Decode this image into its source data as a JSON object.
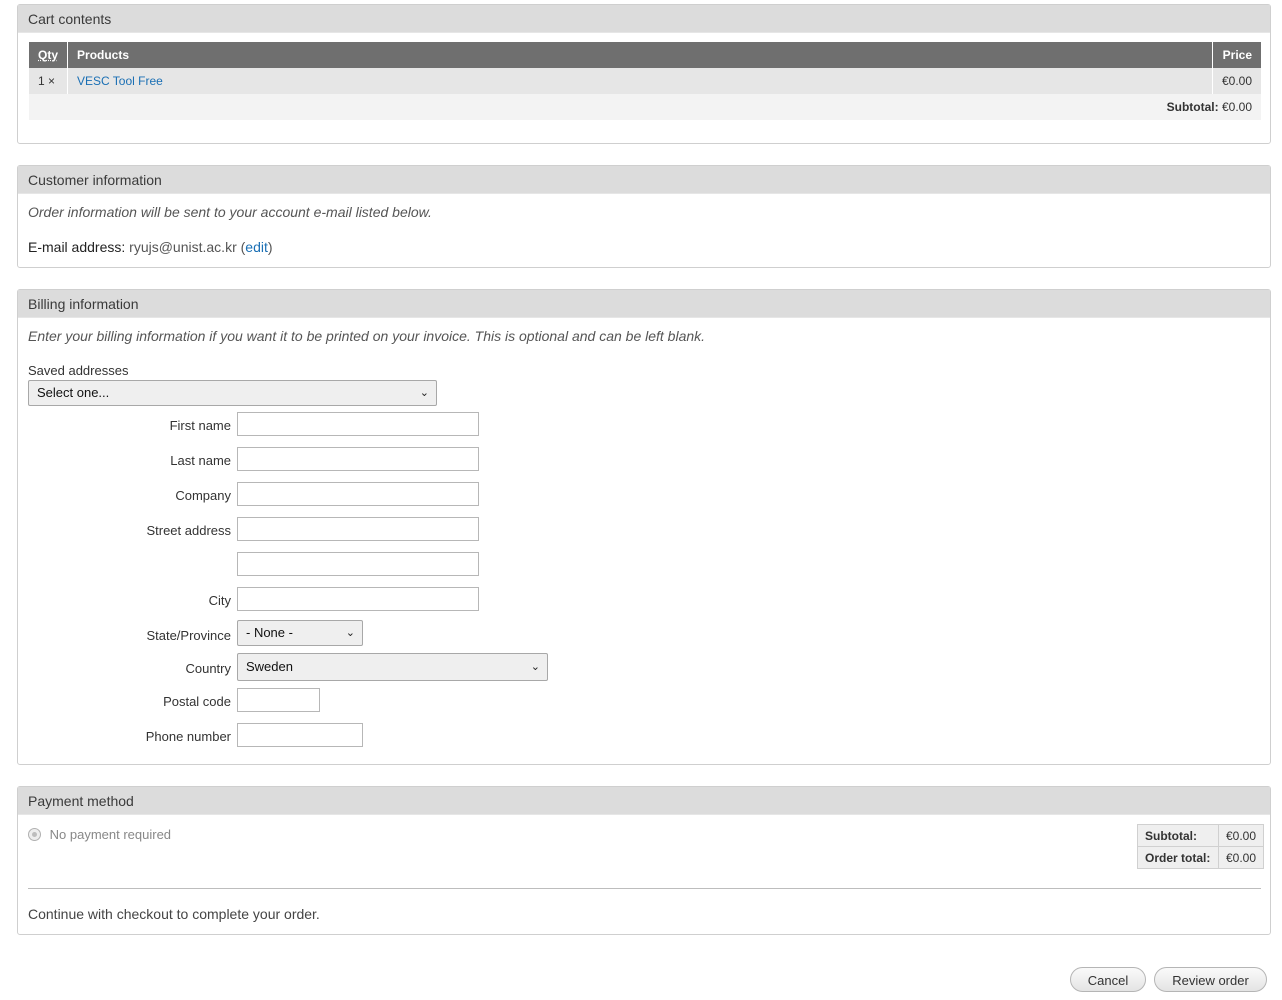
{
  "cart": {
    "title": "Cart contents",
    "headers": {
      "qty": "Qty",
      "products": "Products",
      "price": "Price"
    },
    "items": [
      {
        "qty": "1 ×",
        "product": "VESC Tool Free",
        "price": "€0.00"
      }
    ],
    "subtotal_label": "Subtotal:",
    "subtotal_value": "€0.00"
  },
  "customer": {
    "title": "Customer information",
    "note": "Order information will be sent to your account e-mail listed below.",
    "email_label": "E-mail address:",
    "email_value": "ryujs@unist.ac.kr",
    "edit_open": "(",
    "edit_link": "edit",
    "edit_close": ")"
  },
  "billing": {
    "title": "Billing information",
    "note": "Enter your billing information if you want it to be printed on your invoice. This is optional and can be left blank.",
    "saved_addresses_label": "Saved addresses",
    "saved_addresses_selected": "Select one...",
    "first_name_label": "First name",
    "last_name_label": "Last name",
    "company_label": "Company",
    "street_label": "Street address",
    "city_label": "City",
    "state_label": "State/Province",
    "state_selected": "- None -",
    "country_label": "Country",
    "country_selected": "Sweden",
    "postal_label": "Postal code",
    "phone_label": "Phone number"
  },
  "payment": {
    "title": "Payment method",
    "option_label": "No payment required",
    "subtotal_label": "Subtotal:",
    "subtotal_value": "€0.00",
    "order_total_label": "Order total:",
    "order_total_value": "€0.00",
    "continue_note": "Continue with checkout to complete your order."
  },
  "actions": {
    "cancel": "Cancel",
    "review": "Review order"
  }
}
